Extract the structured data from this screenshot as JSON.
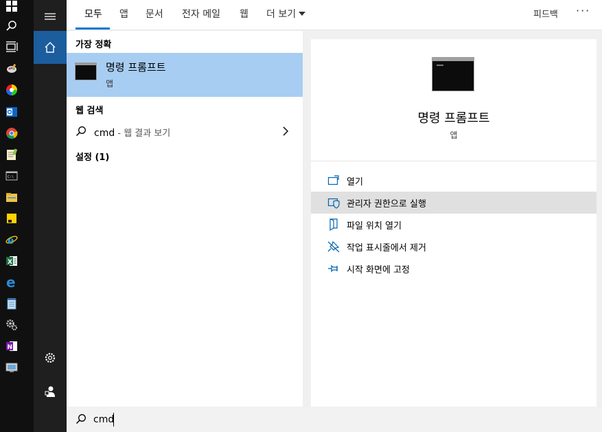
{
  "tabs": {
    "all": "모두",
    "apps": "앱",
    "documents": "문서",
    "email": "전자 메일",
    "web": "웹",
    "more": "더 보기",
    "feedback": "피드백",
    "options": "···"
  },
  "results": {
    "best_match_header": "가장 정확",
    "best_match": {
      "title": "명령 프롬프트",
      "subtitle": "앱"
    },
    "web_search_header": "웹 검색",
    "web_query": "cmd",
    "web_suffix": " - 웹 결과 보기",
    "settings_header": "설정 (1)"
  },
  "detail": {
    "title": "명령 프롬프트",
    "subtitle": "앱",
    "actions": [
      {
        "label": "열기",
        "icon": "open-icon"
      },
      {
        "label": "관리자 권한으로 실행",
        "icon": "shield-icon"
      },
      {
        "label": "파일 위치 열기",
        "icon": "file-location-icon"
      },
      {
        "label": "작업 표시줄에서 제거",
        "icon": "unpin-icon"
      },
      {
        "label": "시작 화면에 고정",
        "icon": "pin-icon"
      }
    ]
  },
  "search": {
    "value": "cmd"
  },
  "colors": {
    "accent": "#0078d7",
    "selection": "#a8cdf2",
    "home_active": "#1c5d9e"
  }
}
